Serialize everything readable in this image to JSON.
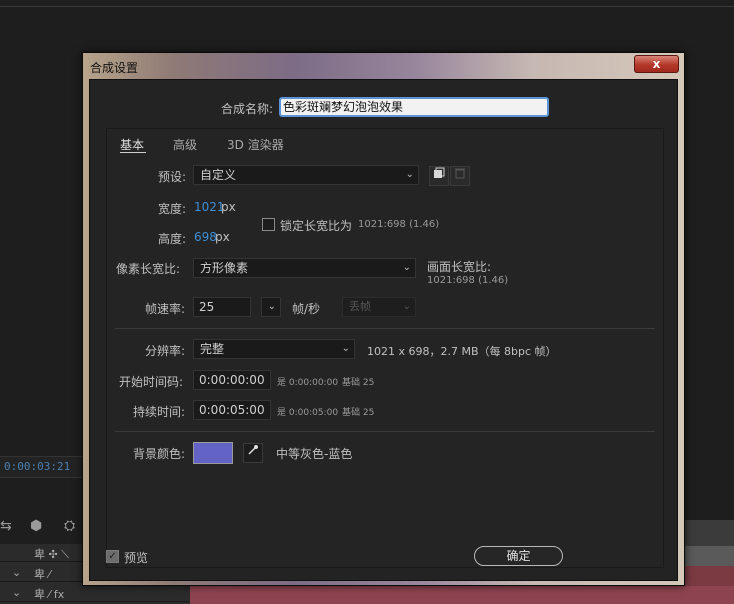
{
  "background": {
    "timecode": "0:00:03:21",
    "tool_glyphs": [
      "⇆",
      "⬢",
      "⛭"
    ],
    "layer_rows": [
      {
        "arrow": "⌄",
        "switches": "卑 ⁄"
      },
      {
        "arrow": "⌄",
        "switches": "卑 ⁄ fx"
      }
    ],
    "layer_header": "卑 ✣ ⟍"
  },
  "dialog": {
    "title": "合成设置",
    "close_label": "x",
    "comp_name_label": "合成名称:",
    "comp_name_value": "色彩斑斓梦幻泡泡效果",
    "tabs": [
      {
        "label": "基本",
        "active": true
      },
      {
        "label": "高级",
        "active": false
      },
      {
        "label": "3D 渲染器",
        "active": false
      }
    ],
    "preset": {
      "label": "预设:",
      "value": "自定义"
    },
    "width": {
      "label": "宽度:",
      "value": "1021",
      "unit": "px"
    },
    "height": {
      "label": "高度:",
      "value": "698",
      "unit": "px"
    },
    "lock_aspect": {
      "label": "锁定长宽比为",
      "ratio": "1021:698 (1.46)",
      "checked": false
    },
    "pixel_aspect": {
      "label": "像素长宽比:",
      "value": "方形像素"
    },
    "frame_aspect": {
      "label": "画面长宽比:",
      "value": "1021:698 (1.46)"
    },
    "frame_rate": {
      "label": "帧速率:",
      "value": "25",
      "unit": "帧/秒",
      "dropframe": "丢帧"
    },
    "resolution": {
      "label": "分辨率:",
      "value": "完整",
      "info": "1021 x 698，2.7 MB（每 8bpc 帧）"
    },
    "start_timecode": {
      "label": "开始时间码:",
      "value": "0:00:00:00",
      "is": "是 0:00:00:00",
      "base": "基础 25"
    },
    "duration": {
      "label": "持续时间:",
      "value": "0:00:05:00",
      "is": "是 0:00:05:00",
      "base": "基础 25"
    },
    "bg_color": {
      "label": "背景颜色:",
      "color": "#6363c6",
      "name": "中等灰色-蓝色"
    },
    "preview": {
      "label": "预览",
      "checked": true
    },
    "ok_label": "确定"
  }
}
